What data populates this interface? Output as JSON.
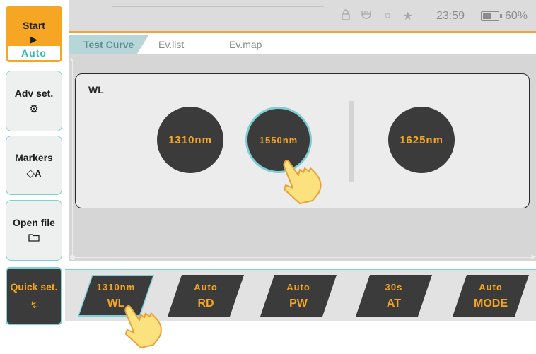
{
  "sidebar": {
    "start": {
      "label": "Start",
      "icon": "play-icon",
      "mode": "Auto"
    },
    "adv_set": {
      "label": "Adv set.",
      "icon": "gear-icon"
    },
    "markers": {
      "label": "Markers",
      "icon": "diamond-marker-icon",
      "marker_letter": "A"
    },
    "open_file": {
      "label": "Open file",
      "icon": "folder-icon"
    },
    "quick_set": {
      "label": "Quick set.",
      "icon": "lightning-icon"
    }
  },
  "status": {
    "icons": [
      "lock-icon",
      "plug-icon",
      "brightness-icon",
      "sun-icon"
    ],
    "time": "23:59",
    "battery_icon": "battery-icon",
    "battery_level": 60,
    "battery_pct": "60%"
  },
  "tabs": [
    {
      "label": "Test Curve",
      "active": true
    },
    {
      "label": "Ev.list",
      "active": false
    },
    {
      "label": "Ev.map",
      "active": false
    }
  ],
  "wl_popup": {
    "title": "WL",
    "options": [
      {
        "label": "1310nm",
        "selected": false
      },
      {
        "label": "1550nm",
        "selected": true
      },
      {
        "label": "1625nm",
        "selected": false
      }
    ]
  },
  "quick_settings": [
    {
      "value": "1310nm",
      "key": "WL",
      "active": true
    },
    {
      "value": "Auto",
      "key": "RD",
      "active": false
    },
    {
      "value": "Auto",
      "key": "PW",
      "active": false
    },
    {
      "value": "30s",
      "key": "AT",
      "active": false
    },
    {
      "value": "Auto",
      "key": "MODE",
      "active": false
    }
  ],
  "colors": {
    "accent_orange": "#f6a623",
    "accent_teal": "#7ccfd3",
    "dark_button": "#3b3b3b"
  }
}
